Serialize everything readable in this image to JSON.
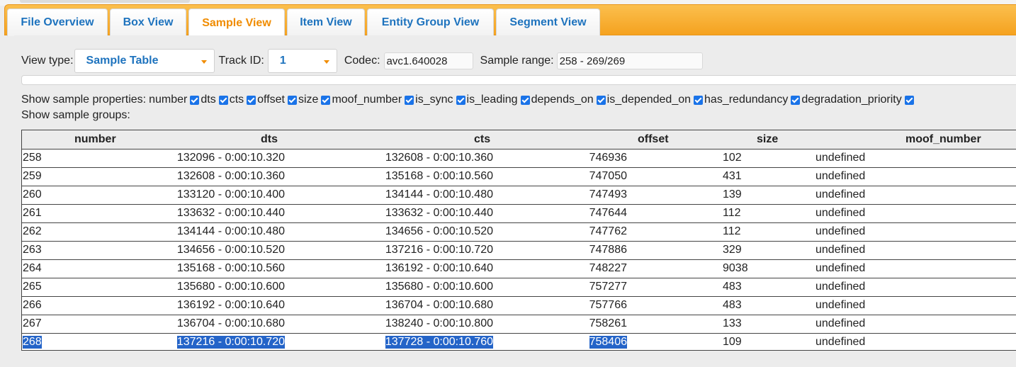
{
  "tabs": [
    {
      "label": "File Overview",
      "active": false
    },
    {
      "label": "Box View",
      "active": false
    },
    {
      "label": "Sample View",
      "active": true
    },
    {
      "label": "Item View",
      "active": false
    },
    {
      "label": "Entity Group View",
      "active": false
    },
    {
      "label": "Segment View",
      "active": false
    }
  ],
  "controls": {
    "view_type_label": "View type:",
    "view_type_value": "Sample Table",
    "track_id_label": "Track ID:",
    "track_id_value": "1",
    "codec_label": "Codec:",
    "codec_value": "avc1.640028",
    "sample_range_label": "Sample range:",
    "sample_range_value": "258 - 269/269"
  },
  "properties": {
    "label": "Show sample properties:",
    "items": [
      "number",
      "dts",
      "cts",
      "offset",
      "size",
      "moof_number",
      "is_sync",
      "is_leading",
      "depends_on",
      "is_depended_on",
      "has_redundancy",
      "degradation_priority"
    ]
  },
  "groups": {
    "label": "Show sample groups:"
  },
  "table": {
    "columns": [
      "number",
      "dts",
      "cts",
      "offset",
      "size",
      "moof_number"
    ],
    "rows": [
      {
        "number": "258",
        "dts": "132096 - 0:00:10.320",
        "cts": "132608 - 0:00:10.360",
        "offset": "746936",
        "size": "102",
        "moof": "undefined"
      },
      {
        "number": "259",
        "dts": "132608 - 0:00:10.360",
        "cts": "135168 - 0:00:10.560",
        "offset": "747050",
        "size": "431",
        "moof": "undefined"
      },
      {
        "number": "260",
        "dts": "133120 - 0:00:10.400",
        "cts": "134144 - 0:00:10.480",
        "offset": "747493",
        "size": "139",
        "moof": "undefined"
      },
      {
        "number": "261",
        "dts": "133632 - 0:00:10.440",
        "cts": "133632 - 0:00:10.440",
        "offset": "747644",
        "size": "112",
        "moof": "undefined"
      },
      {
        "number": "262",
        "dts": "134144 - 0:00:10.480",
        "cts": "134656 - 0:00:10.520",
        "offset": "747762",
        "size": "112",
        "moof": "undefined"
      },
      {
        "number": "263",
        "dts": "134656 - 0:00:10.520",
        "cts": "137216 - 0:00:10.720",
        "offset": "747886",
        "size": "329",
        "moof": "undefined"
      },
      {
        "number": "264",
        "dts": "135168 - 0:00:10.560",
        "cts": "136192 - 0:00:10.640",
        "offset": "748227",
        "size": "9038",
        "moof": "undefined"
      },
      {
        "number": "265",
        "dts": "135680 - 0:00:10.600",
        "cts": "135680 - 0:00:10.600",
        "offset": "757277",
        "size": "483",
        "moof": "undefined"
      },
      {
        "number": "266",
        "dts": "136192 - 0:00:10.640",
        "cts": "136704 - 0:00:10.680",
        "offset": "757766",
        "size": "483",
        "moof": "undefined"
      },
      {
        "number": "267",
        "dts": "136704 - 0:00:10.680",
        "cts": "138240 - 0:00:10.800",
        "offset": "758261",
        "size": "133",
        "moof": "undefined"
      },
      {
        "number": "268",
        "dts": "137216 - 0:00:10.720",
        "cts": "137728 - 0:00:10.760",
        "offset": "758406",
        "size": "109",
        "moof": "undefined"
      }
    ]
  },
  "colors": {
    "tab_accent": "#f5a21f",
    "tab_link": "#1e73be",
    "tab_active_text": "#f08c00",
    "checkbox": "#1a73e8",
    "selection": "#2464c8"
  }
}
